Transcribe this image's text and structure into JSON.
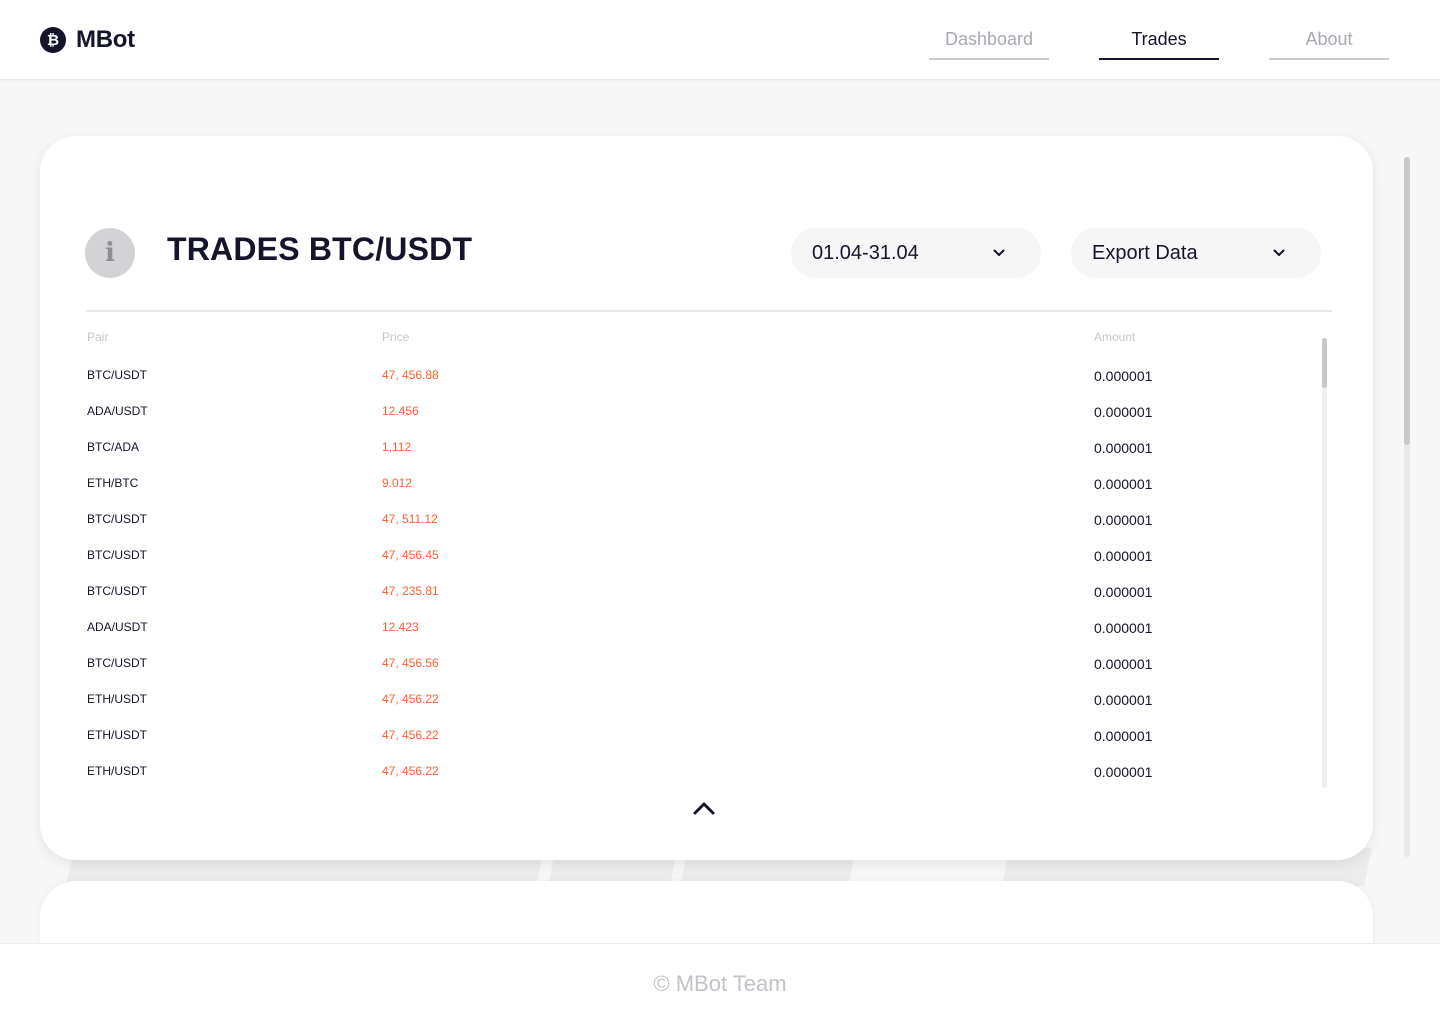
{
  "header": {
    "logo_icon": "bitcoin-icon",
    "logo_glyph": "₿",
    "app_name": "MBot",
    "nav": [
      {
        "label": "Dashboard",
        "active": false
      },
      {
        "label": "Trades",
        "active": true
      },
      {
        "label": "About",
        "active": false
      }
    ]
  },
  "card": {
    "info_icon": "info-icon",
    "info_glyph": "i",
    "title": "TRADES BTC/USDT",
    "date_range": "01.04-31.04",
    "export_label": "Export Data"
  },
  "table": {
    "columns": {
      "pair": "Pair",
      "price": "Price",
      "amount": "Amount"
    },
    "rows": [
      {
        "pair": "BTC/USDT",
        "price": "47, 456.88",
        "amount": "0.000001"
      },
      {
        "pair": "ADA/USDT",
        "price": "12.456",
        "amount": "0.000001"
      },
      {
        "pair": "BTC/ADA",
        "price": "1,112",
        "amount": "0.000001"
      },
      {
        "pair": "ETH/BTC",
        "price": "9.012",
        "amount": "0.000001"
      },
      {
        "pair": "BTC/USDT",
        "price": "47, 511.12",
        "amount": "0.000001"
      },
      {
        "pair": "BTC/USDT",
        "price": "47, 456.45",
        "amount": "0.000001"
      },
      {
        "pair": "BTC/USDT",
        "price": "47, 235.81",
        "amount": "0.000001"
      },
      {
        "pair": "ADA/USDT",
        "price": "12.423",
        "amount": "0.000001"
      },
      {
        "pair": "BTC/USDT",
        "price": "47, 456.56",
        "amount": "0.000001"
      },
      {
        "pair": "ETH/USDT",
        "price": "47, 456.22",
        "amount": "0.000001"
      },
      {
        "pair": "ETH/USDT",
        "price": "47, 456.22",
        "amount": "0.000001"
      },
      {
        "pair": "ETH/USDT",
        "price": "47, 456.22",
        "amount": "0.000001"
      }
    ]
  },
  "footer": {
    "text": "© MBot Team"
  },
  "colors": {
    "primary": "#14142b",
    "price": "#ff5f2e",
    "muted": "#a8a8b3",
    "background": "#f7f7f7"
  }
}
